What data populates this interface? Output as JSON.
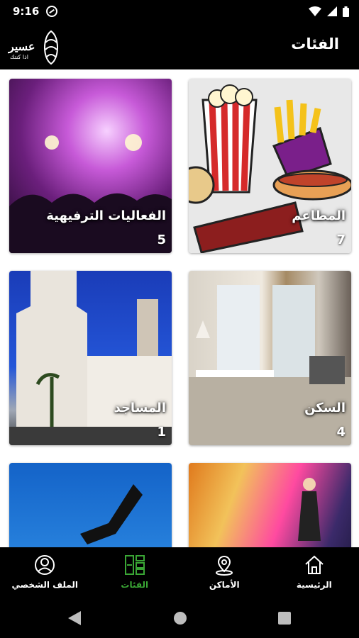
{
  "status": {
    "time": "9:16"
  },
  "header": {
    "title": "الفئات",
    "logo_text": "عسير",
    "logo_sub": "اذا كنتك"
  },
  "categories": [
    {
      "name": "المطاعم",
      "count": "7"
    },
    {
      "name": "الفعاليات الترفيهية",
      "count": "5"
    },
    {
      "name": "السكن",
      "count": "4"
    },
    {
      "name": "المساجد",
      "count": "1"
    },
    {
      "name": "",
      "count": ""
    },
    {
      "name": "",
      "count": ""
    }
  ],
  "nav": [
    {
      "label": "الرئيسية",
      "icon": "home-icon"
    },
    {
      "label": "الأماكن",
      "icon": "map-pin-icon"
    },
    {
      "label": "الفئات",
      "icon": "categories-icon"
    },
    {
      "label": "الملف الشخصي",
      "icon": "profile-icon"
    }
  ],
  "colors": {
    "accent": "#3aa635",
    "background": "#000000",
    "content": "#ffffff"
  }
}
